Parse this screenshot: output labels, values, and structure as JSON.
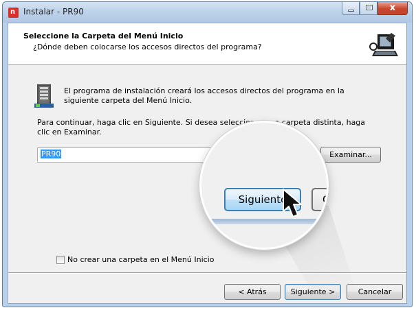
{
  "window": {
    "title": "Instalar - PR90",
    "close_glyph": "x"
  },
  "header": {
    "title": "Seleccione la Carpeta del Menú Inicio",
    "subtitle": "¿Dónde deben colocarse los accesos directos del programa?",
    "image_icon": "computer-installer-icon"
  },
  "body": {
    "info_text": "El programa de instalación creará los accesos directos del programa en la siguiente carpeta del Menú Inicio.",
    "continue_text": "Para continuar, haga clic en Siguiente. Si desea seleccionar una carpeta distinta, haga clic en Examinar.",
    "folder_value": "PR90",
    "browse_label": "Examinar...",
    "no_folder_label": "No crear una carpeta en el Menú Inicio"
  },
  "footer": {
    "back_label": "< Atrás",
    "next_label": "Siguiente >",
    "cancel_label": "Cancelar"
  },
  "magnifier": {
    "next_label": "Siguiente",
    "cancel_partial": "C"
  },
  "colors": {
    "accent": "#3c7fb1",
    "selection": "#3399ff",
    "close_button": "#c9462c"
  }
}
